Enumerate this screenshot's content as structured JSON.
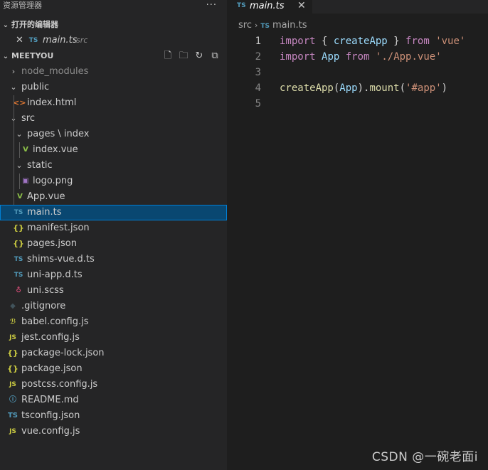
{
  "explorer": {
    "title": "资源管理器",
    "more": "···"
  },
  "open_editors": {
    "header": "打开的编辑器",
    "items": [
      {
        "close": "✕",
        "icon": "TS",
        "name": "main.ts",
        "path": "src"
      }
    ]
  },
  "project": {
    "header": "MEETYOU",
    "toolbar": {
      "new_file_icon": "new-file-icon",
      "new_folder_icon": "new-folder-icon",
      "refresh_icon": "refresh-icon",
      "collapse_icon": "collapse-all-icon"
    },
    "tree": [
      {
        "label": "node_modules",
        "chev": "›",
        "dim": true
      },
      {
        "label": "public",
        "chev": "⌄"
      },
      {
        "label": "index.html",
        "icon": "<>"
      },
      {
        "label": "src",
        "chev": "⌄"
      },
      {
        "label": "pages \\ index",
        "chev": "⌄"
      },
      {
        "label": "index.vue",
        "icon": "V"
      },
      {
        "label": "static",
        "chev": "⌄"
      },
      {
        "label": "logo.png",
        "icon": "▣"
      },
      {
        "label": "App.vue",
        "icon": "V"
      },
      {
        "label": "main.ts",
        "icon": "TS",
        "selected": true
      },
      {
        "label": "manifest.json",
        "icon": "{}"
      },
      {
        "label": "pages.json",
        "icon": "{}"
      },
      {
        "label": "shims-vue.d.ts",
        "icon": "TS"
      },
      {
        "label": "uni-app.d.ts",
        "icon": "TS"
      },
      {
        "label": "uni.scss",
        "icon": "♁"
      },
      {
        "label": ".gitignore",
        "icon": "◆"
      },
      {
        "label": "babel.config.js",
        "icon": "ℬ"
      },
      {
        "label": "jest.config.js",
        "icon": "JS"
      },
      {
        "label": "package-lock.json",
        "icon": "{}"
      },
      {
        "label": "package.json",
        "icon": "{}"
      },
      {
        "label": "postcss.config.js",
        "icon": "JS"
      },
      {
        "label": "README.md",
        "icon": "ⓘ"
      },
      {
        "label": "tsconfig.json",
        "icon": "TS"
      },
      {
        "label": "vue.config.js",
        "icon": "JS"
      }
    ]
  },
  "editor": {
    "tab": {
      "icon": "TS",
      "name": "main.ts",
      "close": "✕"
    },
    "breadcrumb": {
      "folder": "src",
      "sep": "›",
      "icon": "TS",
      "file": "main.ts"
    },
    "lines": [
      {
        "n": "1",
        "tokens": [
          [
            "kw",
            "import"
          ],
          [
            "pn",
            " { "
          ],
          [
            "id",
            "createApp"
          ],
          [
            "pn",
            " } "
          ],
          [
            "kw",
            "from"
          ],
          [
            "pn",
            " "
          ],
          [
            "str",
            "'vue'"
          ]
        ]
      },
      {
        "n": "2",
        "tokens": [
          [
            "kw",
            "import"
          ],
          [
            "pn",
            " "
          ],
          [
            "id",
            "App"
          ],
          [
            "pn",
            " "
          ],
          [
            "kw",
            "from"
          ],
          [
            "pn",
            " "
          ],
          [
            "str",
            "'./App.vue'"
          ]
        ]
      },
      {
        "n": "3",
        "tokens": []
      },
      {
        "n": "4",
        "tokens": [
          [
            "fn",
            "createApp"
          ],
          [
            "pn",
            "("
          ],
          [
            "id",
            "App"
          ],
          [
            "pn",
            ")."
          ],
          [
            "fn",
            "mount"
          ],
          [
            "pn",
            "("
          ],
          [
            "str",
            "'#app'"
          ],
          [
            "pn",
            ")"
          ]
        ]
      },
      {
        "n": "5",
        "tokens": []
      }
    ]
  },
  "watermark": "CSDN @一碗老面i"
}
